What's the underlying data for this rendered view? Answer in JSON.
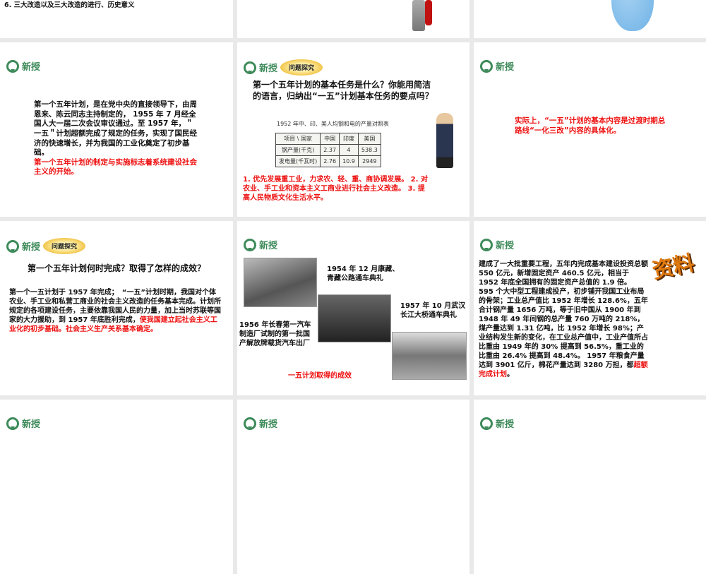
{
  "section_label": "新授",
  "badge": "问题探究",
  "slides": {
    "top_left": {
      "text": "6. 三大改造以及三大改造的进行、历史意义"
    },
    "s1": {
      "body": "第一个五年计划，是在党中央的直接领导下，由周恩来、陈云同志主持制定的， 1955 年 7 月经全国人大一届二次会议审议通过。至 1957 年，＂一五＂计划超额完成了规定的任务，实现了国民经济的快速增长，并为我国的工业化奠定了初步基础。",
      "red": "第一个五年计划的制定与实施标志着系统建设社会主义的开始。"
    },
    "s2": {
      "question": "第一个五年计划的基本任务是什么？你能用简洁的语言，归纳出“一五”计划基本任务的要点吗？",
      "table_title": "1952 年中、印、美人均钢和电的产量对照表",
      "table_header": [
        "项目 \\ 国家",
        "中国",
        "印度",
        "美国"
      ],
      "table_rows": [
        [
          "钢产量(千克)",
          "2.37",
          "4",
          "538.3"
        ],
        [
          "发电量(千瓦时)",
          "2.76",
          "10.9",
          "2949"
        ]
      ],
      "answer": "1. 优先发展重工业，力求农、轻、重、商协调发展。 2. 对农业、手工业和资本主义工商业进行社会主义改造。 3. 提高人民物质文化生活水平。"
    },
    "s3": {
      "red": "实际上，“一五”计划的基本内容是过渡时期总路线“一化三改”内容的具体化。"
    },
    "s4": {
      "question": "第一个五年计划何时完成？取得了怎样的成效？",
      "body": "第一个一五计划于 1957 年完成；　“一五”计划时期，我国对个体农业、手工业和私营工商业的社会主义改造的任务基本完成。计划所规定的各项建设任务，主要依靠我国人民的力量，加上当时苏联等国家的大力援助，到 1957 年底胜利完成，",
      "red": "使我国建立起社会主义工业化的初步基础。社会主义生产关系基本确定。"
    },
    "s5": {
      "cap1": "1954 年 12 月康藏、青藏公路通车典礼",
      "cap2": "1957 年 10 月武汉长江大桥通车典礼",
      "cap3": "1956 年长春第一汽车制造厂试制的第一批国产解放牌载货汽车出厂",
      "footer": "一五计划取得的成效"
    },
    "s6": {
      "body": "建成了一大批重要工程，五年内完成基本建设投资总额 550 亿元，新增固定资产 460.5 亿元，相当于 1952 年底全国拥有的固定资产总值的 1.9 倍。 595 个大中型工程建成投产，初步铺开我国工业布局的骨架；工业总产值比 1952 年增长 128.6%，五年合计钢产量 1656 万吨，等于旧中国从 1900 年到 1948 年 49 年间钢的总产量 760 万吨的 218%，煤产量达到 1.31 亿吨，比 1952 年增长 98%；产业结构发生新的变化，在工业总产值中，工业产值所占比重由 1949 年的 30% 提高到 56.5%，重工业的比重由 26.4% 提高到 48.4%。 1957 年粮食产量达到 3901 亿斤，棉花产量达到 3280 万担，都",
      "red": "超额完成计划",
      "end": "。",
      "stamp": "资料"
    }
  }
}
